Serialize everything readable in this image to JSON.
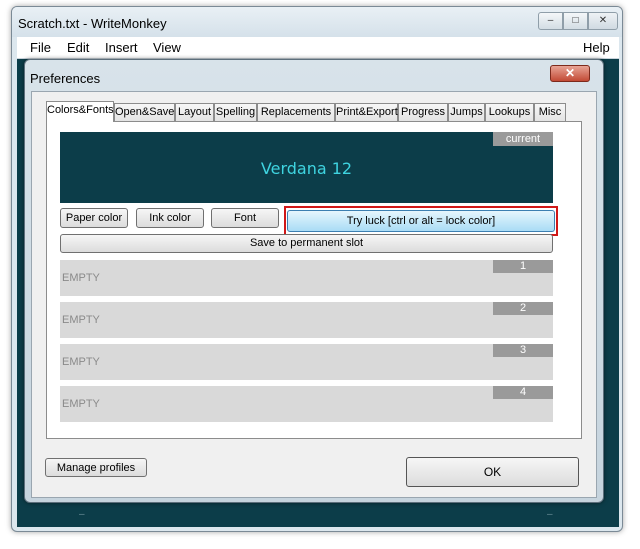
{
  "window": {
    "title": "Scratch.txt  - WriteMonkey",
    "min_glyph": "‒",
    "max_glyph": "□",
    "close_glyph": "✕"
  },
  "menu": {
    "file": "File",
    "edit": "Edit",
    "insert": "Insert",
    "view": "View",
    "help": "Help"
  },
  "editor": {
    "scroll_mark": "‒"
  },
  "dialog": {
    "title": "Preferences",
    "close_glyph": "✕"
  },
  "tabs": [
    "Colors&Fonts",
    "Open&Save",
    "Layout",
    "Spelling",
    "Replacements",
    "Print&Export",
    "Progress",
    "Jumps",
    "Lookups",
    "Misc"
  ],
  "preview": {
    "badge": "current",
    "font_label": "Verdana 12",
    "background": "#0c3d49",
    "ink": "#3fd4e0"
  },
  "buttons": {
    "paper_color": "Paper color",
    "ink_color": "Ink color",
    "font": "Font",
    "try_luck": "Try luck   [ctrl or alt = lock color]",
    "save_slot": "Save to permanent slot",
    "manage_profiles": "Manage profiles",
    "ok": "OK"
  },
  "slots": [
    {
      "label": "EMPTY",
      "number": "1"
    },
    {
      "label": "EMPTY",
      "number": "2"
    },
    {
      "label": "EMPTY",
      "number": "3"
    },
    {
      "label": "EMPTY",
      "number": "4"
    }
  ],
  "colors": {
    "highlight": "#d01818",
    "dialog_close": "#c24a35"
  }
}
